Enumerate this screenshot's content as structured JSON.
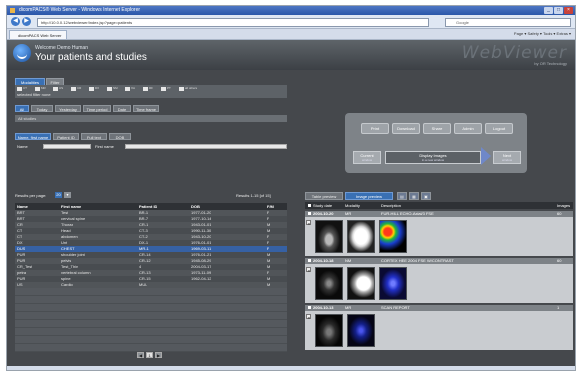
{
  "browser": {
    "title": "dicomPACS® Web Server - Windows Internet Explorer",
    "url": "http://10.0.0.12/webviewer/index.jsp?page=patients",
    "search_placeholder": "Google",
    "tab": "dicomPACS Web Server",
    "commands": "Page ▾  Safety ▾  Tools ▾  Extras ▾",
    "win_min": "_",
    "win_max": "□",
    "win_close": "×",
    "back_icon": "◀",
    "forward_icon": "▶"
  },
  "header": {
    "welcome": "Welcome Demo Human",
    "subtitle": "Your patients and studies",
    "brand": "WebViewer",
    "brand_sub": "by OR Technology"
  },
  "left": {
    "tabs": [
      "Modalities",
      "Filter"
    ],
    "modalities": [
      "CT",
      "MR",
      "US",
      "CR",
      "DX",
      "NM",
      "XA",
      "RF",
      "PT",
      "all others"
    ],
    "selected_modalities": "selected filter none",
    "filters": [
      "All",
      "Today",
      "Yesterday",
      "Time period",
      "Date",
      "Time frame"
    ],
    "filter_status": "All studies",
    "search_tabs": [
      "Name, first name",
      "Patient ID",
      "Full text",
      "DOB"
    ],
    "name_label": "Name",
    "firstname_label": "First name",
    "results_per_page_label": "Results per page:",
    "results_per_page": "20",
    "results_text": "Results 1-15 [of 15]",
    "columns": [
      "Name",
      "First name",
      "Patient ID",
      "DOB",
      "F/M"
    ],
    "rows": [
      [
        "BRT",
        "Test",
        "BR-1",
        "1977-01-20",
        "F"
      ],
      [
        "BRT",
        "cervical spine",
        "BR-7",
        "1977-10-14",
        "F"
      ],
      [
        "CR",
        "Thorax",
        "CR-1",
        "1943-01-01",
        "M"
      ],
      [
        "CT",
        "Head",
        "CT-3",
        "1990-11-30",
        "M"
      ],
      [
        "CT",
        "abdomen",
        "CT-2",
        "1943-10-20",
        "F"
      ],
      [
        "DX",
        "Unt",
        "DX-1",
        "1976-01-01",
        "F"
      ],
      [
        "DUS",
        "CHEST",
        "MR-1",
        "1969-03-11",
        "F"
      ],
      [
        "PUR",
        "shoulder joint",
        "CR-14",
        "1976-01-21",
        "M"
      ],
      [
        "PUR",
        "pelvis",
        "CR-12",
        "1945-08-29",
        "M"
      ],
      [
        "CR_Test",
        "Test_Thin",
        "4",
        "2004-03-17",
        "M"
      ],
      [
        "petra",
        "vertebral column",
        "CR-13",
        "1973-11-09",
        "F"
      ],
      [
        "PUR",
        "spine",
        "CR-15",
        "1962-04-12",
        "M"
      ],
      [
        "US",
        "Cardio",
        "MUL",
        "",
        "M"
      ]
    ],
    "selected_row": 6,
    "pager": [
      "◀",
      "1",
      "▶"
    ]
  },
  "actions": [
    "Print",
    "Download",
    "Share",
    "Admin",
    "Logout"
  ],
  "compare": {
    "current": {
      "label": "Current",
      "sub": "window"
    },
    "display": {
      "label": "Display Images",
      "sub": "in a new window"
    },
    "next": {
      "label": "Next",
      "sub": "window"
    }
  },
  "right": {
    "tabs": [
      "Table preview",
      "Image preview"
    ],
    "small_tabs": [
      "▤",
      "▦",
      "▣"
    ],
    "columns": [
      "Study date",
      "Modality",
      "Description",
      "Images"
    ],
    "series": [
      {
        "date": "2004-10-20",
        "mod": "MR",
        "desc": "FUR-HILL ECHO-Axial/3 FSE",
        "images": "60",
        "thumbs": [
          "mr-axial",
          "mr-head",
          "colormap-a",
          ""
        ]
      },
      {
        "date": "2004-10-18",
        "mod": "NM",
        "desc": "CORTEX HEE 2004 FSE W/CONTRAST",
        "images": "60",
        "thumbs": [
          "nm-spine",
          "mr-profile",
          "nm-blue",
          ""
        ]
      },
      {
        "date": "2004-10-13",
        "mod": "MR",
        "desc": "SCAN REPORT",
        "images": "1",
        "thumbs": [
          "mr-dark",
          "nm-blue-2",
          "",
          ""
        ]
      }
    ]
  },
  "colors": {
    "accent": "#3970b4",
    "selected_row": "#3661a4",
    "bg": "#45484c"
  }
}
